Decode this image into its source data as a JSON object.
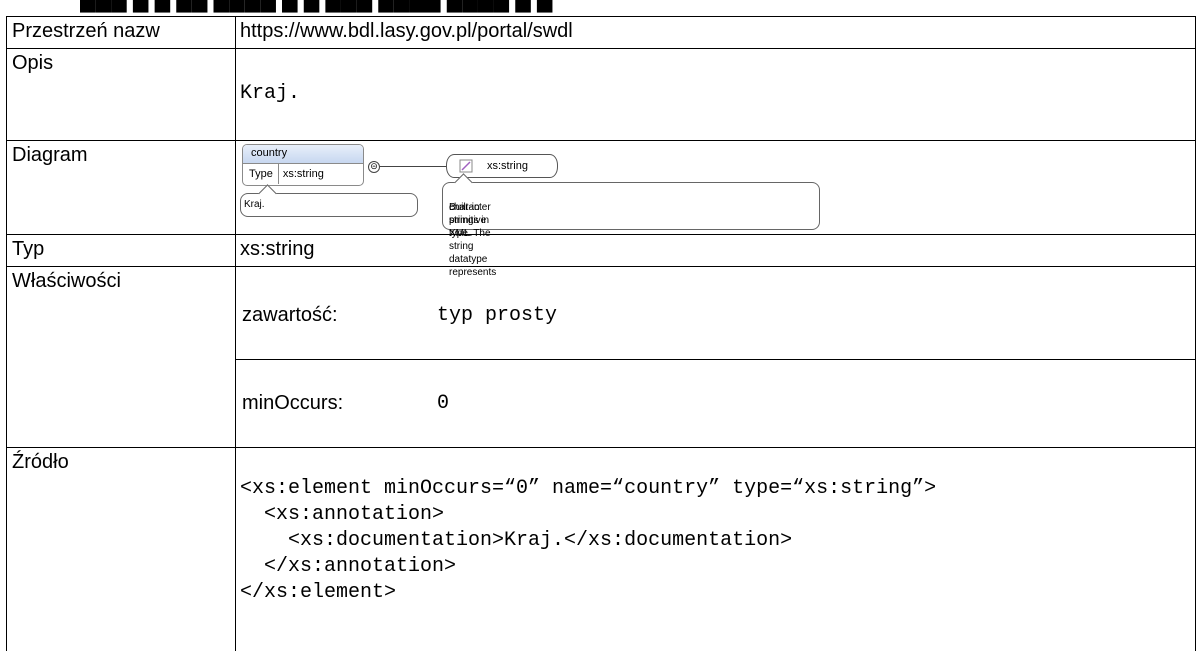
{
  "top_strip_text": "Przestrzeń nazw, Opis, Diagram, Typ, Właściwości",
  "rows": {
    "namespace": {
      "label": "Przestrzeń nazw",
      "value": "https://www.bdl.lasy.gov.pl/portal/swdl"
    },
    "description": {
      "label": "Opis",
      "value": "Kraj."
    },
    "diagram": {
      "label": "Diagram",
      "element_name": "country",
      "type_label": "Type",
      "type_value": "xs:string",
      "element_doc": "Kraj.",
      "type_box_label": "xs:string",
      "type_doc_line1": "Built-in primitive type. The string datatype represents",
      "type_doc_line2": "character strings in XML.",
      "connector_symbol": "⊝"
    },
    "type": {
      "label": "Typ",
      "value": "xs:string"
    },
    "properties": {
      "label": "Właściwości",
      "items": [
        {
          "key": "zawartość:",
          "value": "typ prosty"
        },
        {
          "key": "minOccurs:",
          "value": "0"
        }
      ]
    },
    "source": {
      "label": "Źródło",
      "code": "<xs:element minOccurs=“0” name=“country” type=“xs:string”>\n  <xs:annotation>\n    <xs:documentation>Kraj.</xs:documentation>\n  </xs:annotation>\n</xs:element>"
    }
  }
}
